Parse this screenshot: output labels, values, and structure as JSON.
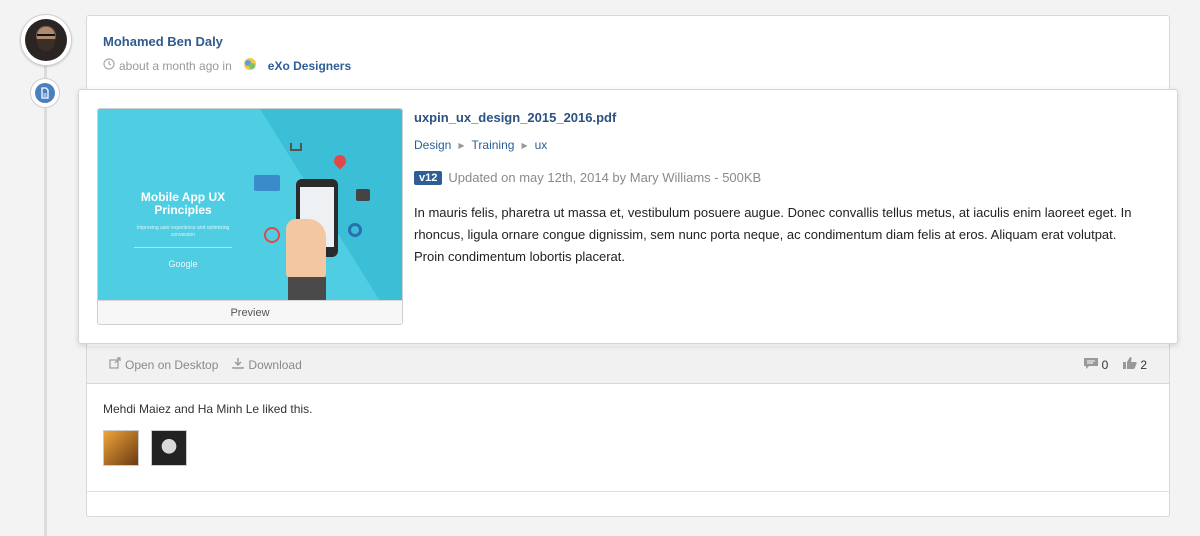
{
  "activity": {
    "author": "Mohamed Ben Daly",
    "time": "about a month ago in",
    "space": "eXo Designers"
  },
  "file": {
    "name": "uxpin_ux_design_2015_2016.pdf",
    "breadcrumb": [
      "Design",
      "Training",
      "ux"
    ],
    "version": "v12",
    "updated": "Updated on may 12th, 2014 by Mary Williams - 500KB",
    "description": "In mauris felis, pharetra ut massa et, vestibulum posuere augue. Donec convallis tellus metus, at iaculis enim laoreet eget. In rhoncus, ligula ornare congue dignissim, sem nunc porta neque, ac condimentum diam felis at eros. Aliquam erat volutpat. Proin condimentum lobortis placerat.",
    "thumbnail": {
      "title": "Mobile App UX Principles",
      "subtitle": "Improving user experience and optimizing conversion",
      "brand": "Google",
      "preview_label": "Preview"
    }
  },
  "actions": {
    "open_desktop": "Open on Desktop",
    "download": "Download",
    "comments_count": "0",
    "likes_count": "2"
  },
  "likes": {
    "text": "Mehdi Maiez and Ha Minh Le liked this."
  },
  "colors": {
    "accent": "#2e5e96",
    "thumb_bg": "#3bbfd6"
  }
}
